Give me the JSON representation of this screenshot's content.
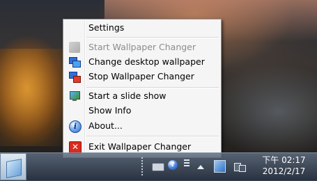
{
  "context_menu": {
    "items": [
      {
        "label": "Settings",
        "enabled": true,
        "icon": ""
      },
      {
        "label": "Start Wallpaper Changer",
        "enabled": false,
        "icon": "start-icon"
      },
      {
        "label": "Change desktop wallpaper",
        "enabled": true,
        "icon": "monitors-icon"
      },
      {
        "label": "Stop Wallpaper Changer",
        "enabled": true,
        "icon": "stop-monitor-icon"
      },
      {
        "label": "Start a slide show",
        "enabled": true,
        "icon": "slideshow-icon"
      },
      {
        "label": "Show Info",
        "enabled": true,
        "icon": ""
      },
      {
        "label": "About...",
        "enabled": true,
        "icon": "info-icon"
      },
      {
        "label": "Exit Wallpaper Changer",
        "enabled": true,
        "icon": "exit-icon"
      }
    ]
  },
  "tray": {
    "help_glyph": "?",
    "info_glyph": "i",
    "exit_glyph": "✕",
    "clock_time": "下午 02:17",
    "clock_date": "2012/2/17"
  }
}
